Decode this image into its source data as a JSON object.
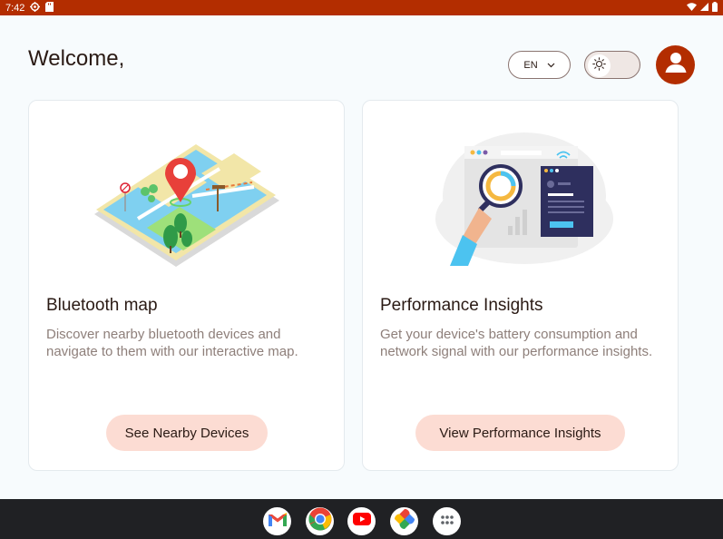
{
  "status_bar": {
    "time": "7:42",
    "left_icons": [
      "settings-gear-icon",
      "sd-card-icon"
    ],
    "right_icons": [
      "wifi-icon",
      "cellular-signal-icon",
      "battery-icon"
    ],
    "background_color": "#b32d00"
  },
  "header": {
    "welcome_text": "Welcome,",
    "language": {
      "selected": "EN",
      "icon": "chevron-down-icon"
    },
    "theme_toggle": {
      "icon": "sun-icon",
      "state": "light"
    },
    "avatar_icon": "user-account-icon",
    "accent_color": "#b32d00"
  },
  "cards": {
    "bluetooth": {
      "illustration": "isometric-map-illustration",
      "title": "Bluetooth map",
      "description": "Discover nearby bluetooth devices and navigate to them with our interactive map.",
      "button_label": "See Nearby Devices"
    },
    "performance": {
      "illustration": "performance-dashboard-illustration",
      "title": "Performance Insights",
      "description": "Get your device's battery consumption and network signal with our performance insights.",
      "button_label": "View Performance Insights"
    },
    "button_color": "#fcdcd3"
  },
  "taskbar": {
    "apps": [
      "gmail-icon",
      "chrome-icon",
      "youtube-icon",
      "photos-icon",
      "app-drawer-icon"
    ]
  }
}
